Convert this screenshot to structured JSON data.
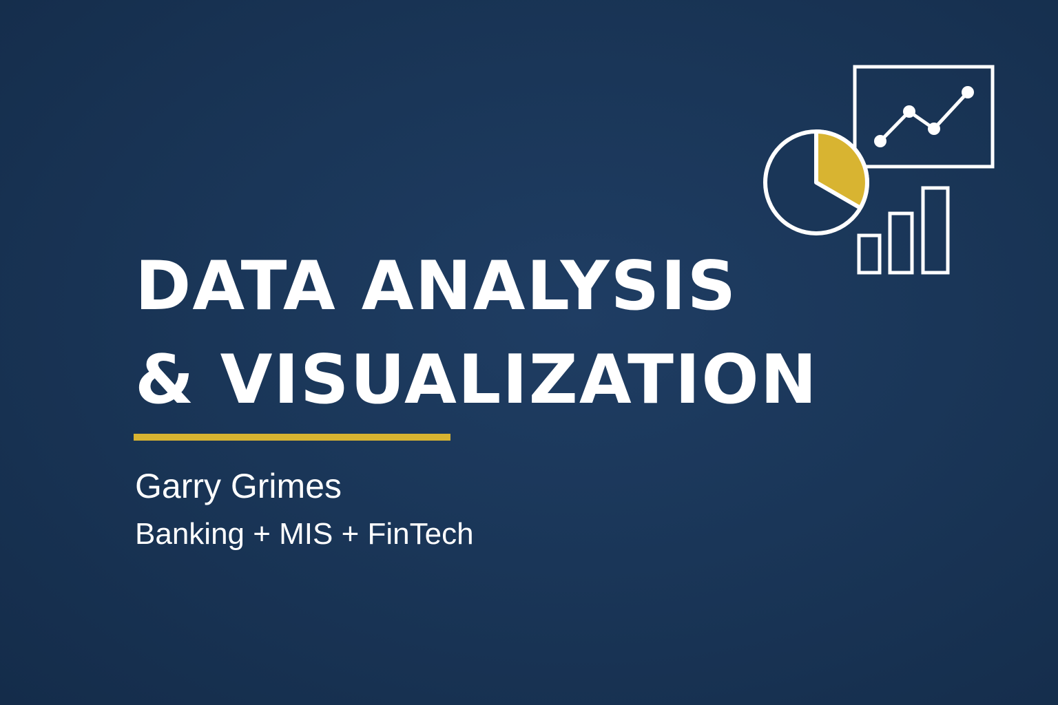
{
  "hero": {
    "title_line1": "DATA ANALYSIS",
    "title_line2": "& VISUALIZATION",
    "author": "Garry Grimes",
    "tagline": "Banking + MIS + FinTech"
  },
  "icons": [
    "pie-chart-icon",
    "line-chart-icon",
    "bar-chart-icon"
  ],
  "colors": {
    "background": "#1a3658",
    "accent": "#d8b431",
    "text": "#ffffff"
  }
}
